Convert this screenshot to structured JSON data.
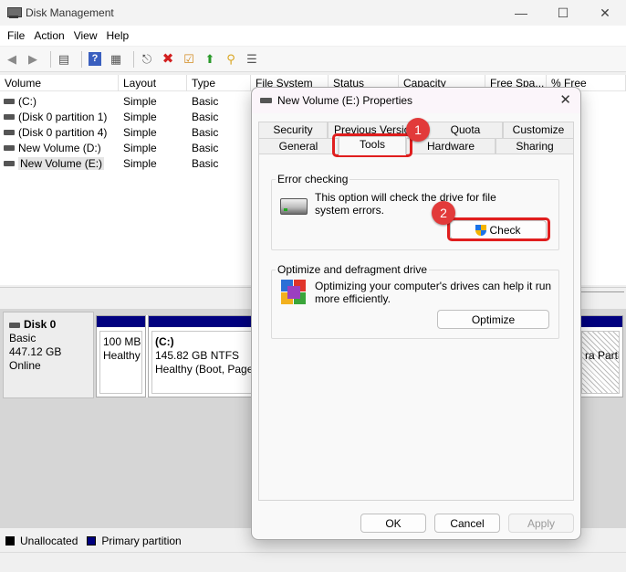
{
  "window": {
    "title": "Disk Management"
  },
  "menu": [
    "File",
    "Action",
    "View",
    "Help"
  ],
  "volume_list": {
    "headers": [
      "Volume",
      "Layout",
      "Type",
      "File System",
      "Status",
      "Capacity",
      "Free Spa...",
      "% Free"
    ],
    "rows": [
      {
        "volume": "(C:)",
        "layout": "Simple",
        "type": "Basic"
      },
      {
        "volume": "(Disk 0 partition 1)",
        "layout": "Simple",
        "type": "Basic"
      },
      {
        "volume": "(Disk 0 partition 4)",
        "layout": "Simple",
        "type": "Basic"
      },
      {
        "volume": "New Volume (D:)",
        "layout": "Simple",
        "type": "Basic"
      },
      {
        "volume": "New Volume (E:)",
        "layout": "Simple",
        "type": "Basic"
      }
    ]
  },
  "disk": {
    "name": "Disk 0",
    "type": "Basic",
    "size": "447.12 GB",
    "status": "Online",
    "partitions": [
      {
        "size": "100 MB",
        "status": "Healthy"
      },
      {
        "label": "(C:)",
        "size": "145.82 GB NTFS",
        "status": "Healthy (Boot, Page"
      },
      {
        "status": "ra Partiti"
      }
    ]
  },
  "legend": [
    {
      "label": "Unallocated",
      "color": "#000000"
    },
    {
      "label": "Primary partition",
      "color": "#00007f"
    }
  ],
  "dialog": {
    "title": "New Volume (E:) Properties",
    "tabs_row1": [
      "Security",
      "Previous Versions",
      "Quota",
      "Customize"
    ],
    "tabs_row2": [
      "General",
      "Tools",
      "Hardware",
      "Sharing"
    ],
    "active_tab": "Tools",
    "error_checking": {
      "title": "Error checking",
      "text_line1": "This option will check the drive for file",
      "text_line2": "system errors.",
      "button": "Check"
    },
    "optimize": {
      "title": "Optimize and defragment drive",
      "text_line1": "Optimizing your computer's drives can help it run",
      "text_line2": "more efficiently.",
      "button": "Optimize"
    },
    "buttons": {
      "ok": "OK",
      "cancel": "Cancel",
      "apply": "Apply"
    }
  },
  "annotations": {
    "step1": "1",
    "step2": "2",
    "color": "#e01e1e"
  }
}
